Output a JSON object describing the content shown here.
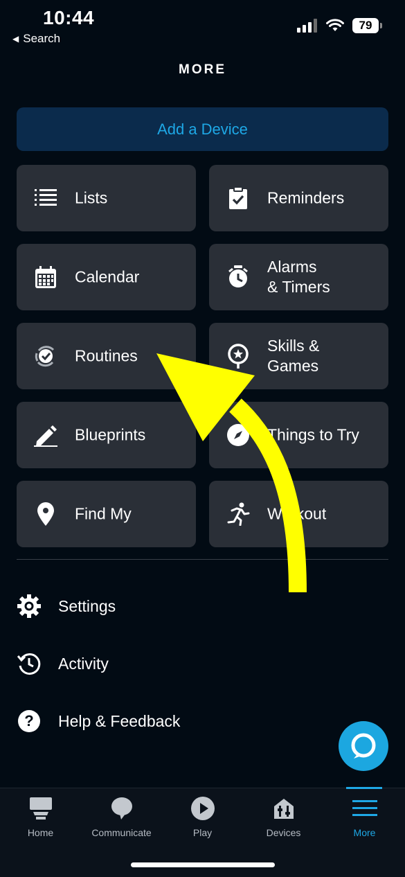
{
  "status_bar": {
    "time": "10:44",
    "back_label": "Search",
    "battery": "79"
  },
  "header": {
    "title": "MORE"
  },
  "add_device": {
    "label": "Add a Device"
  },
  "tiles": [
    {
      "label_line1": "Lists",
      "label_line2": "",
      "icon": "list-icon"
    },
    {
      "label_line1": "Reminders",
      "label_line2": "",
      "icon": "clipboard-check-icon"
    },
    {
      "label_line1": "Calendar",
      "label_line2": "",
      "icon": "calendar-icon"
    },
    {
      "label_line1": "Alarms",
      "label_line2": "& Timers",
      "icon": "alarm-clock-icon"
    },
    {
      "label_line1": "Routines",
      "label_line2": "",
      "icon": "routines-check-icon"
    },
    {
      "label_line1": "Skills &",
      "label_line2": "Games",
      "icon": "skills-pin-icon"
    },
    {
      "label_line1": "Blueprints",
      "label_line2": "",
      "icon": "pencil-icon"
    },
    {
      "label_line1": "Things to Try",
      "label_line2": "",
      "icon": "compass-icon"
    },
    {
      "label_line1": "Find My",
      "label_line2": "",
      "icon": "location-pin-icon"
    },
    {
      "label_line1": "Workout",
      "label_line2": "",
      "icon": "runner-icon"
    }
  ],
  "menu": [
    {
      "label": "Settings",
      "icon": "gear-icon"
    },
    {
      "label": "Activity",
      "icon": "history-icon"
    },
    {
      "label": "Help & Feedback",
      "icon": "help-icon"
    }
  ],
  "tabbar": {
    "tabs": [
      {
        "label": "Home",
        "icon": "home-icon"
      },
      {
        "label": "Communicate",
        "icon": "chat-bubble-icon"
      },
      {
        "label": "Play",
        "icon": "play-icon"
      },
      {
        "label": "Devices",
        "icon": "devices-icon"
      },
      {
        "label": "More",
        "icon": "menu-icon"
      }
    ],
    "active": "More"
  },
  "colors": {
    "accent": "#1ea8e6",
    "tile_bg": "#2a2f37",
    "page_bg": "#020b14",
    "add_device_bg": "#0b2b4c",
    "arrow": "#ffff00"
  }
}
